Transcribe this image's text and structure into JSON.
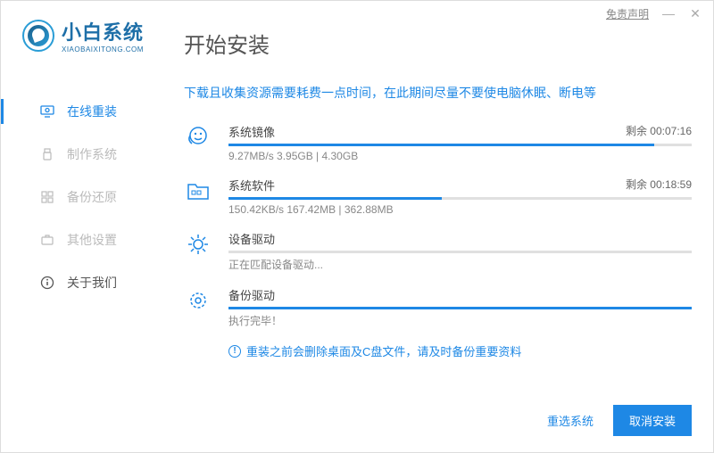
{
  "titlebar": {
    "disclaimer": "免责声明"
  },
  "brand": {
    "title": "小白系统",
    "sub": "XIAOBAIXITONG.COM"
  },
  "sidebar": {
    "items": [
      {
        "label": "在线重装"
      },
      {
        "label": "制作系统"
      },
      {
        "label": "备份还原"
      },
      {
        "label": "其他设置"
      },
      {
        "label": "关于我们"
      }
    ]
  },
  "main": {
    "title": "开始安装",
    "notice": "下载且收集资源需要耗费一点时间，在此期间尽量不要使电脑休眠、断电等",
    "tasks": [
      {
        "name": "系统镜像",
        "detail": "9.27MB/s 3.95GB | 4.30GB",
        "remain": "剩余 00:07:16",
        "progress": 92
      },
      {
        "name": "系统软件",
        "detail": "150.42KB/s 167.42MB | 362.88MB",
        "remain": "剩余 00:18:59",
        "progress": 46
      },
      {
        "name": "设备驱动",
        "detail": "正在匹配设备驱动...",
        "remain": "",
        "progress": 0
      },
      {
        "name": "备份驱动",
        "detail": "执行完毕！",
        "remain": "",
        "progress": 100
      }
    ],
    "warning": "重装之前会删除桌面及C盘文件，请及时备份重要资料"
  },
  "footer": {
    "reselect": "重选系统",
    "cancel": "取消安装"
  }
}
